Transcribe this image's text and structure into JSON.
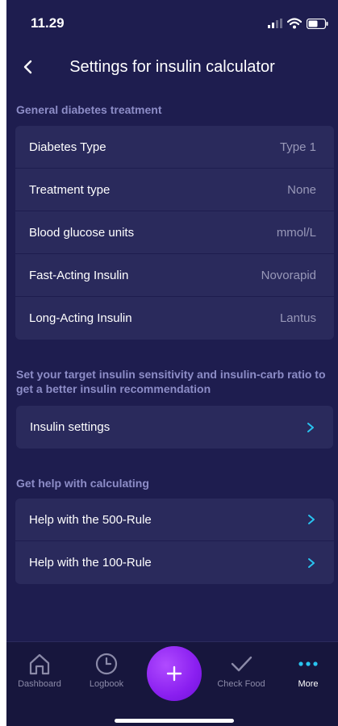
{
  "status": {
    "time": "11.29"
  },
  "header": {
    "title": "Settings for insulin calculator"
  },
  "general": {
    "title": "General diabetes treatment",
    "rows": [
      {
        "label": "Diabetes Type",
        "value": "Type 1"
      },
      {
        "label": "Treatment type",
        "value": "None"
      },
      {
        "label": "Blood glucose units",
        "value": "mmol/L"
      },
      {
        "label": "Fast-Acting Insulin",
        "value": "Novorapid"
      },
      {
        "label": "Long-Acting Insulin",
        "value": "Lantus"
      }
    ]
  },
  "insulin_section": {
    "title": "Set your target insulin sensitivity and insulin-carb ratio to get a better insulin recommendation",
    "settings_label": "Insulin settings"
  },
  "help_section": {
    "title": "Get help with calculating",
    "rows": [
      {
        "label": "Help with the 500-Rule"
      },
      {
        "label": "Help with the 100-Rule"
      }
    ]
  },
  "tabs": {
    "dashboard": "Dashboard",
    "logbook": "Logbook",
    "check_food": "Check Food",
    "more": "More"
  },
  "colors": {
    "background": "#1e1d4f",
    "card": "#2a2a5c",
    "section_title": "#8d8dc7",
    "chevron": "#29c4f0",
    "fab": "#9b30ff"
  },
  "icons": {
    "back": "chevron-left-icon",
    "row_chevron": "chevron-right-icon",
    "dashboard": "home-icon",
    "logbook": "clock-icon",
    "add": "plus-icon",
    "check_food": "checkmark-icon",
    "more": "more-dots-icon"
  }
}
